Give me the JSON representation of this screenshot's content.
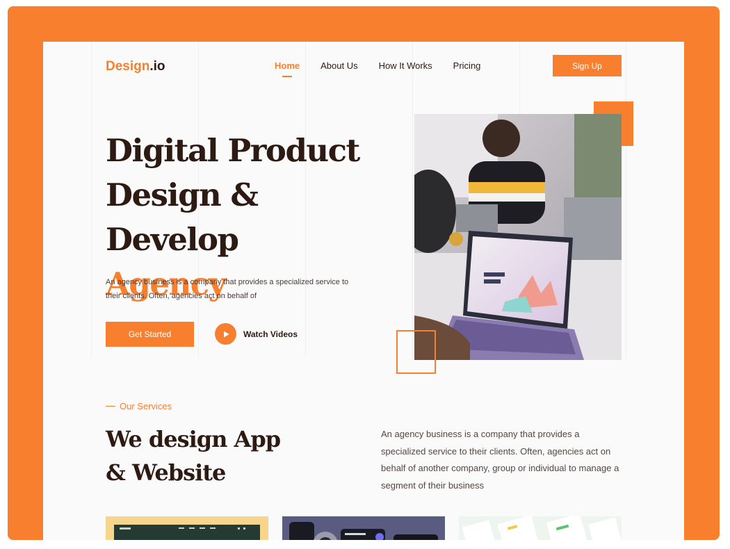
{
  "brand": {
    "logo_main": "Design",
    "logo_tld": ".io"
  },
  "nav": {
    "items": [
      {
        "label": "Home",
        "active": true
      },
      {
        "label": "About Us",
        "active": false
      },
      {
        "label": "How It Works",
        "active": false
      },
      {
        "label": "Pricing",
        "active": false
      }
    ],
    "signup_label": "Sign Up"
  },
  "hero": {
    "title_line1": "Digital Product",
    "title_line2": "Design & Develop",
    "title_accent": "Agency",
    "description": "An agency business is a company that provides a specialized service to their clients. Often, agencies act on behalf of",
    "cta_primary": "Get Started",
    "cta_secondary": "Watch Videos"
  },
  "services": {
    "tag": "Our Services",
    "title_line1": "We design App",
    "title_line2": "& Website",
    "description": "An agency business is a company that provides a specialized service to their clients. Often, agencies act on behalf of another company, group or individual to manage a segment of their business"
  },
  "colors": {
    "accent": "#f77f2e",
    "text_dark": "#2d1a12",
    "page_bg": "#fafafa"
  },
  "icons": {
    "play": "play-icon"
  }
}
